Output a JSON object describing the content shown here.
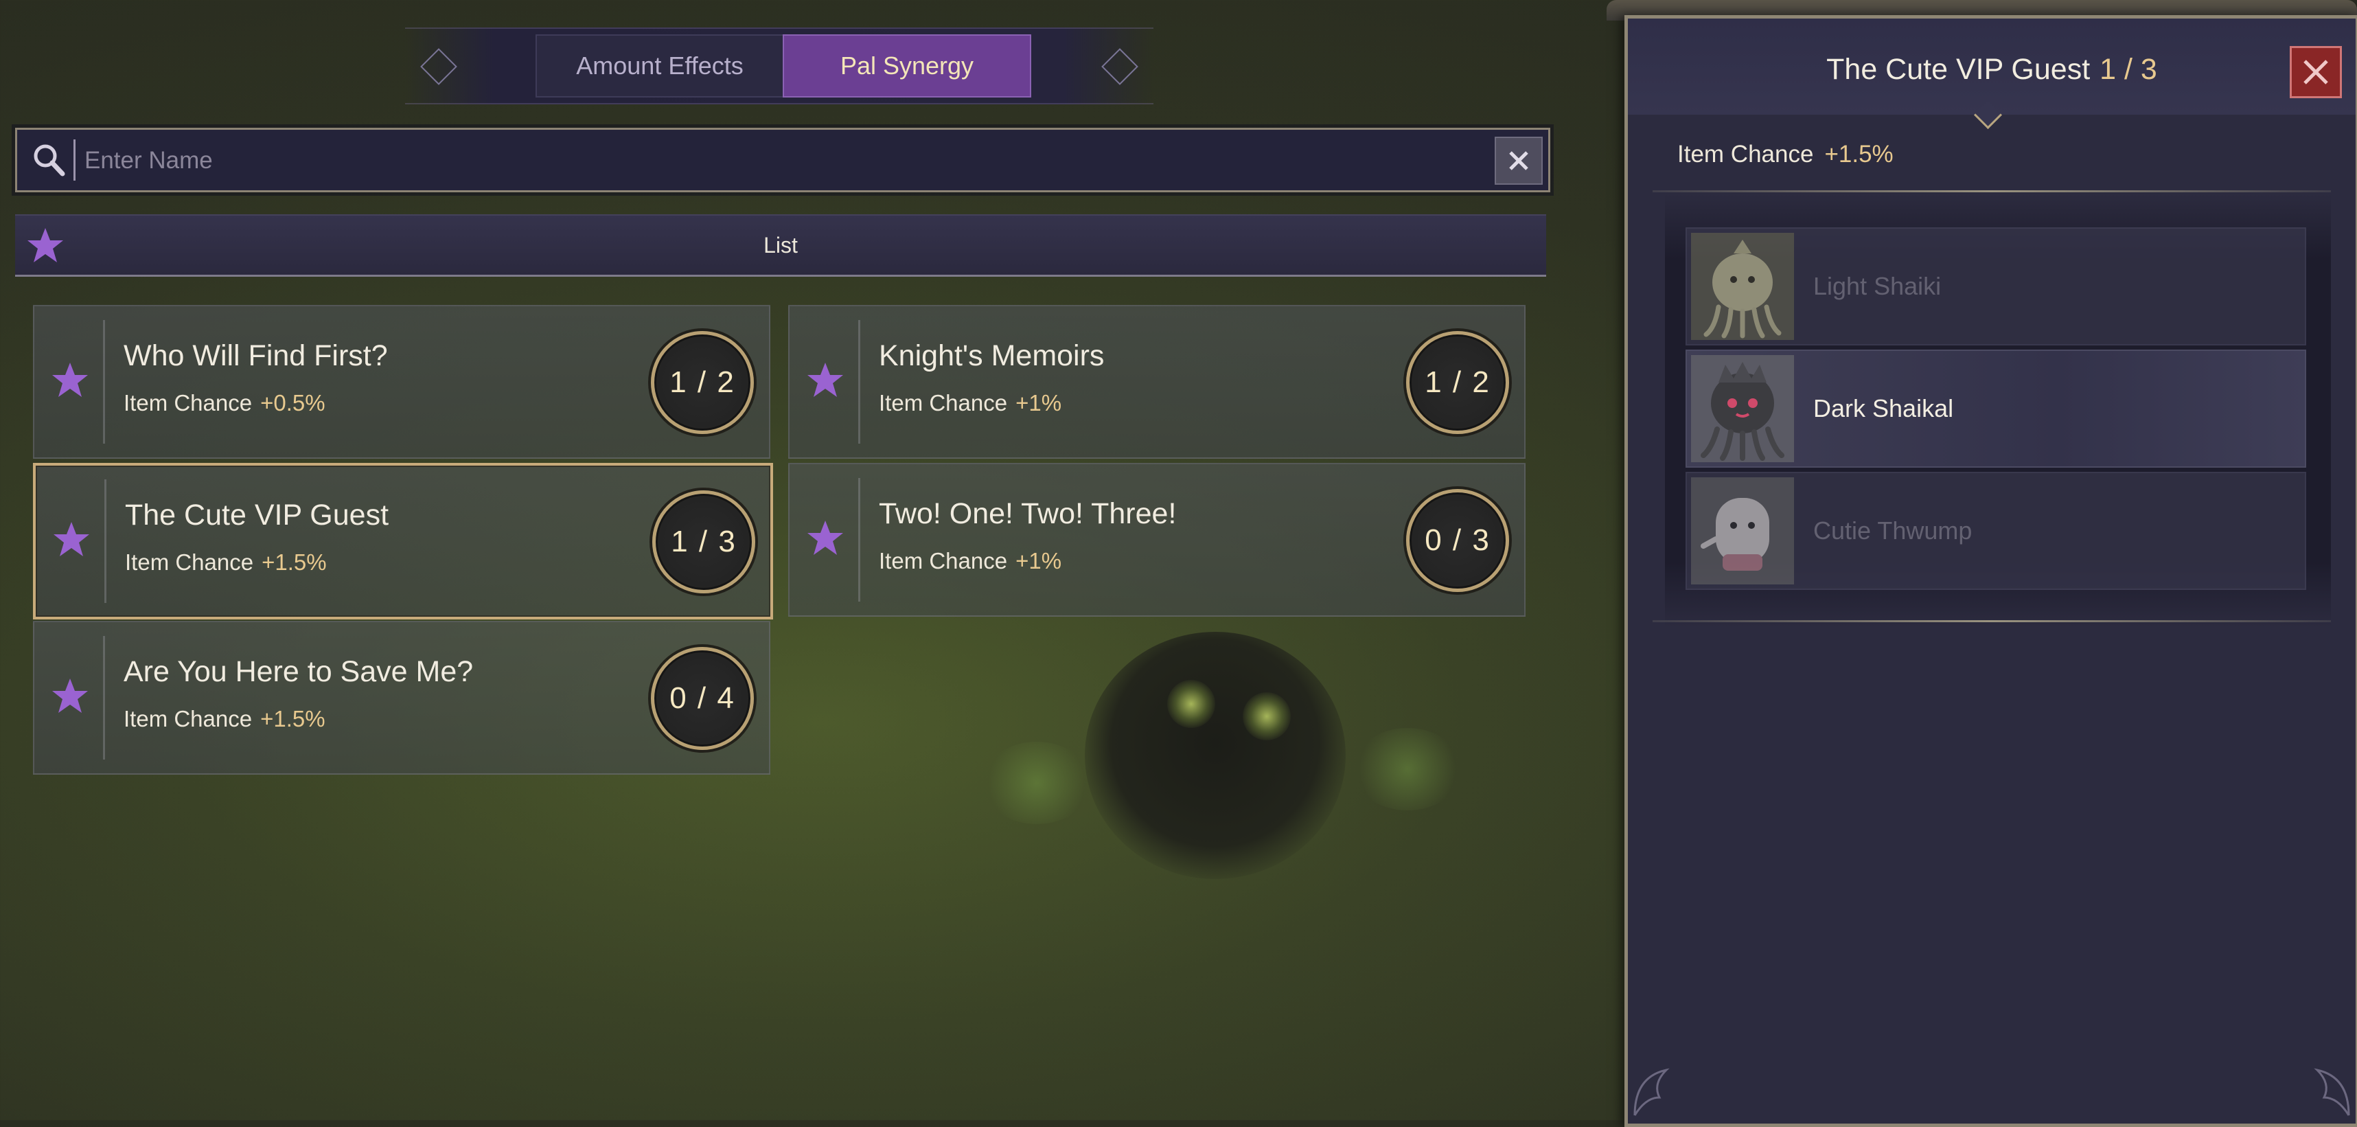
{
  "tabs": [
    {
      "label": "Amount Effects",
      "active": false
    },
    {
      "label": "Pal Synergy",
      "active": true
    }
  ],
  "search": {
    "placeholder": "Enter Name",
    "value": ""
  },
  "list_header": {
    "label": "List"
  },
  "synergies": [
    {
      "title": "Who Will Find First?",
      "effect_label": "Item Chance",
      "effect_value": "+0.5%",
      "count": "1 / 2",
      "selected": false
    },
    {
      "title": "Knight's Memoirs",
      "effect_label": "Item Chance",
      "effect_value": "+1%",
      "count": "1 / 2",
      "selected": false
    },
    {
      "title": "The Cute VIP Guest",
      "effect_label": "Item Chance",
      "effect_value": "+1.5%",
      "count": "1 / 3",
      "selected": true
    },
    {
      "title": "Two! One! Two! Three!",
      "effect_label": "Item Chance",
      "effect_value": "+1%",
      "count": "0 / 3",
      "selected": false
    },
    {
      "title": "Are You Here to Save Me?",
      "effect_label": "Item Chance",
      "effect_value": "+1.5%",
      "count": "0 / 4",
      "selected": false
    }
  ],
  "detail": {
    "title": "The Cute VIP Guest",
    "count": "1 / 3",
    "effect_label": "Item Chance",
    "effect_value": "+1.5%",
    "pals": [
      {
        "name": "Light Shaiki",
        "owned": false,
        "icon": "light-shaiki-portrait"
      },
      {
        "name": "Dark Shaikal",
        "owned": true,
        "icon": "dark-shaikal-portrait"
      },
      {
        "name": "Cutie Thwump",
        "owned": false,
        "icon": "cutie-thwump-portrait"
      }
    ]
  },
  "colors": {
    "accent_purple": "#6b3f93",
    "gold": "#e8c98f",
    "close_red": "#8a2626",
    "star": "#9a63d1"
  },
  "icons": {
    "search": "search-icon",
    "clear": "clear-icon",
    "star": "star-icon",
    "close": "close-icon"
  }
}
